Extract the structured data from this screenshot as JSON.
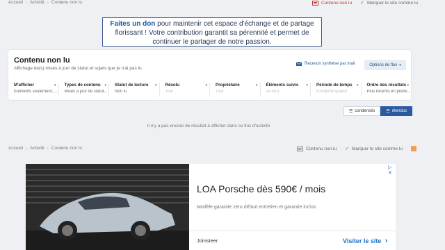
{
  "breadcrumb": [
    "Accueil",
    "Activité",
    "Contenu non lu"
  ],
  "top_actions": {
    "unread": "Contenu non lu",
    "mark_read": "Marquer le site comme lu"
  },
  "donate": {
    "link": "Faites un don",
    "text": " pour maintenir cet espace d'échange et de partage florissant ! Votre contribution garantit sa pérennité et permet de continuer le partager de notre passion."
  },
  "panel": {
    "title": "Contenu non lu",
    "subtitle": "Affichage de(s) mises à jour de statut et sujets que je n'ai pas lu.",
    "receive_mail": "Recevoir synthèse par mail",
    "flux_options": "Options de flux"
  },
  "filters": [
    {
      "label": "M'afficher",
      "value": "Éléments seulement; ...",
      "placeholder": false
    },
    {
      "label": "Types de contenu",
      "value": "Mises à jour de statut...",
      "placeholder": false
    },
    {
      "label": "Statut de lecture",
      "value": "Non lu",
      "placeholder": false
    },
    {
      "label": "Résolu",
      "value": "Tout",
      "placeholder": true
    },
    {
      "label": "Propriétaire",
      "value": "Tout",
      "placeholder": true
    },
    {
      "label": "Éléments suivis",
      "value": "Ze tout",
      "placeholder": true
    },
    {
      "label": "Période de temps",
      "value": "N'importe quand",
      "placeholder": true
    },
    {
      "label": "Ordre des résultats",
      "value": "Plus récents en premi...",
      "placeholder": false
    }
  ],
  "view_toggle": {
    "condensed": "condensés",
    "expanded": "étendus"
  },
  "empty_message": "Il n'y a pas encore de résultat à afficher dans ce flux d'activité",
  "ad": {
    "title": "LOA Porsche dès 590€ / mois",
    "description": "Modèle garantie zero défaut entretien et garantie inclus",
    "advertiser": "Joinsteer",
    "cta": "Visiter le site",
    "cta_arrow": "›",
    "adchoices": "▷ ✕"
  },
  "colors": {
    "accent": "#2a5aa0",
    "link": "#1a5aa6",
    "unread_icon": "#c0392b",
    "rss": "#f0a050"
  }
}
